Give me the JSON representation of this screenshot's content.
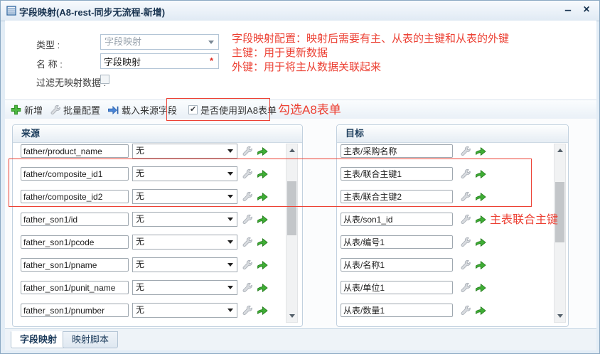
{
  "dialog": {
    "title": "字段映射(A8-rest-同步无流程-新增)",
    "minimize_glyph": "–",
    "close_glyph": "×"
  },
  "form": {
    "type_label": "类型 :",
    "type_value": "字段映射",
    "name_label": "名 称 :",
    "name_value": "字段映射",
    "name_required_mark": "*",
    "filter_label": "过滤无映射数据 :",
    "filter_checked": false
  },
  "notes": {
    "color": "#ec4134",
    "config_lines": [
      "字段映射配置：映射后需要有主、从表的主键和从表的外键",
      "主键：用于更新数据",
      "外键：用于将主从数据关联起来"
    ],
    "a8_note": "勾选A8表单",
    "composite_note": "主表联合主键"
  },
  "toolbar": {
    "add_label": "新增",
    "batch_label": "批量配置",
    "load_label": "载入来源字段",
    "a8_label": "是否使用到A8表单",
    "a8_checked": true
  },
  "source_panel": {
    "title": "来源",
    "rows": [
      {
        "field": "father/product_name",
        "mapping": "无"
      },
      {
        "field": "father/composite_id1",
        "mapping": "无"
      },
      {
        "field": "father/composite_id2",
        "mapping": "无"
      },
      {
        "field": "father_son1/id",
        "mapping": "无"
      },
      {
        "field": "father_son1/pcode",
        "mapping": "无"
      },
      {
        "field": "father_son1/pname",
        "mapping": "无"
      },
      {
        "field": "father_son1/punit_name",
        "mapping": "无"
      },
      {
        "field": "father_son1/pnumber",
        "mapping": "无"
      }
    ]
  },
  "target_panel": {
    "title": "目标",
    "rows": [
      {
        "field": "主表/采购名称"
      },
      {
        "field": "主表/联合主键1"
      },
      {
        "field": "主表/联合主键2"
      },
      {
        "field": "从表/son1_id"
      },
      {
        "field": "从表/编号1"
      },
      {
        "field": "从表/名称1"
      },
      {
        "field": "从表/单位1"
      },
      {
        "field": "从表/数量1"
      }
    ]
  },
  "tabs": [
    {
      "label": "字段映射",
      "active": true
    },
    {
      "label": "映射脚本",
      "active": false
    }
  ],
  "icons": {
    "title": "table-icon",
    "add": "plus-icon",
    "batch": "wrench-icon",
    "load": "import-arrow-icon",
    "row_config": "wrench-icon",
    "row_transfer": "green-arrow-icon"
  }
}
